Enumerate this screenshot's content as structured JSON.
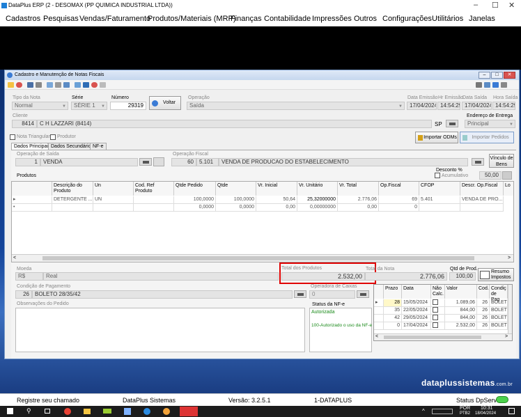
{
  "app": {
    "title": "DataPlus ERP (2 - DESOMAX  (PP QUIMICA INDUSTRIAL LTDA))"
  },
  "menu": [
    "Cadastros",
    "Pesquisas",
    "Vendas/Faturamento",
    "Produtos/Materiais (MRP)",
    "Finanças",
    "Contabilidade",
    "Impressões",
    "Outros",
    "Configurações",
    "Utilitários",
    "Janelas"
  ],
  "window": {
    "title": "Cadastro e Manutenção de Notas Fiscais"
  },
  "header": {
    "tipo_label": "Tipo da Nota",
    "tipo_value": "Normal",
    "serie_label": "Série",
    "serie_value": "SÉRIE 1",
    "numero_label": "Número",
    "numero_value": "29319",
    "voltar_label": "Voltar",
    "operacao_label": "Operação",
    "operacao_value": "Saída",
    "data_emissao_label": "Data Emissão",
    "data_emissao_value": "17/04/2024",
    "hr_emissao_label": "Hr Emissão",
    "hr_emissao_value": "14:54:29",
    "data_saida_label": "Data Saída",
    "data_saida_value": "17/04/2024",
    "hora_saida_label": "Hora Saída",
    "hora_saida_value": "14:54:29",
    "cliente_label": "Cliente",
    "cliente_code": "8414",
    "cliente_name": "C H LAZZARI (8414)",
    "uf": "SP",
    "endereco_label": "Endereço de Entrega",
    "endereco_value": "Principal",
    "nota_triangular": "Nota Triangular",
    "produtor": "Produtor",
    "importar_odms": "Importar ODMs",
    "importar_pedidos": "Importar Pedidos"
  },
  "tabs": [
    "Dados Principais",
    "Dados Secundários",
    "NF-e"
  ],
  "operacao_saida": {
    "label": "Operação de Saída",
    "code": "1",
    "value": "VENDA"
  },
  "operacao_fiscal": {
    "label": "Operação Fiscal",
    "code": "60",
    "cfop": "5.101",
    "desc": "VENDA DE PRODUCAO DO ESTABELECIMENTO"
  },
  "vinculo_label": "Vínculo de Bens",
  "produtos_label": "Produtos",
  "desconto": {
    "label": "Desconto %",
    "acumulativo": "Acumulativo",
    "value": "50,00"
  },
  "grid": {
    "columns": [
      "Descrição do Produto",
      "Un",
      "Cod. Ref Produto",
      "Qtde Pedido",
      "Qtde",
      "Vr. Inicial",
      "Vr. Unitário",
      "Vr. Total",
      "Op.Fiscal",
      "CFOP",
      "Descr. Op.Fiscal",
      "Lo"
    ],
    "rows": [
      [
        "DETERGENTE ...",
        "UN",
        "",
        "100,0000",
        "100,0000",
        "50,64",
        "25,32000000",
        "2.776,06",
        "69",
        "5.401",
        "VENDA DE PRO..."
      ],
      [
        "",
        "",
        "",
        "0,0000",
        "0,0000",
        "0,00",
        "0,00000000",
        "0,00",
        "0",
        "",
        ""
      ]
    ]
  },
  "totals": {
    "moeda_label": "Moeda",
    "moeda_code": "R$",
    "moeda_value": "Real",
    "total_produtos_label": "Total dos Produtos",
    "total_produtos_value": "2.532,00",
    "total_nota_label": "Total da Nota",
    "total_nota_value": "2.776,06",
    "qtd_prod_label": "Qtd de Prod.",
    "qtd_prod_value": "100,00",
    "resumo_label": "Resumo Impostos"
  },
  "pagamento": {
    "label": "Condição de Pagamento",
    "code": "26",
    "value": "BOLETO 28/35/42"
  },
  "caixa": {
    "label": "Operadora de Caixas",
    "value": "0"
  },
  "observacoes_label": "Observações do Pedido",
  "nfe": {
    "label": "Status da NF-e",
    "status": "Autorizada",
    "msg": "100-Autorizado o uso da NF-e"
  },
  "prazos": {
    "columns": [
      "Prazo",
      "Data",
      "Não Calc.",
      "Valor",
      "Cod.",
      "Condiç de Pag"
    ],
    "rows": [
      [
        "28",
        "15/05/2024",
        "",
        "1.089,06",
        "26",
        "BOLETO"
      ],
      [
        "35",
        "22/05/2024",
        "",
        "844,00",
        "26",
        "BOLETO"
      ],
      [
        "42",
        "29/05/2024",
        "",
        "844,00",
        "26",
        "BOLETO"
      ],
      [
        "0",
        "17/04/2024",
        "",
        "2.532,00",
        "26",
        "BOLETO"
      ]
    ]
  },
  "brand": {
    "name": "dataplussistemas",
    "suffix": ".com.br"
  },
  "statusbar": {
    "registre": "Registre seu chamado",
    "sistemas": "DataPlus Sistemas",
    "versao": "Versão: 3.2.5.1",
    "empresa": "1-DATAPLUS",
    "status": "Status DpServer"
  },
  "taskbar": {
    "lang": "POR",
    "layout": "PTB2",
    "time": "10:31",
    "date": "18/04/2024"
  }
}
